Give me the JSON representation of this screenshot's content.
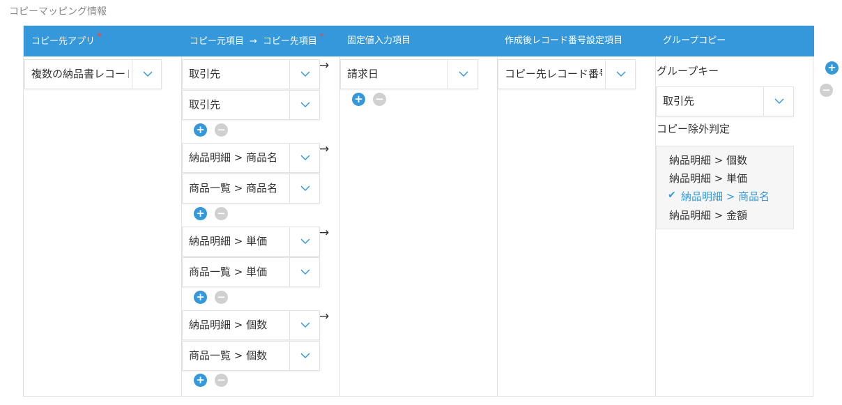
{
  "section_title": "コピーマッピング情報",
  "headers": {
    "copy_dest_app": "コピー先アプリ",
    "src_item": "コピー元項目",
    "arrow": "→",
    "dest_item": "コピー先項目",
    "fixed_value": "固定値入力項目",
    "record_number": "作成後レコード番号設定項目",
    "group_copy": "グループコピー",
    "required_mark": "*"
  },
  "app_select": "複数の納品書レコード",
  "mapping_groups": [
    {
      "sources": [
        "取引先",
        "取引先"
      ]
    },
    {
      "sources": [
        "納品明細 > 商品名",
        "商品一覧 > 商品名"
      ]
    },
    {
      "sources": [
        "納品明細 > 単価",
        "商品一覧 > 単価"
      ]
    },
    {
      "sources": [
        "納品明細 > 個数",
        "商品一覧 > 個数"
      ]
    }
  ],
  "mapping_arrow": "→",
  "fixed_value_select": "請求日",
  "record_number_select": "コピー先レコード番号",
  "group_copy": {
    "group_key_label": "グループキー",
    "group_key_value": "取引先",
    "exclusion_label": "コピー除外判定",
    "exclusion_items": [
      {
        "label": "納品明細 > 個数",
        "checked": false
      },
      {
        "label": "納品明細 > 単価",
        "checked": false
      },
      {
        "label": "納品明細 > 商品名",
        "checked": true
      },
      {
        "label": "納品明細 > 金額",
        "checked": false
      }
    ]
  },
  "icons": {
    "add": "+",
    "remove": "−",
    "check": "✔"
  },
  "colors": {
    "header_bg": "#3498db",
    "required": "#e74c3c",
    "add_button": "#3498db",
    "remove_button": "#d0d0d0",
    "checked_text": "#3498db"
  }
}
